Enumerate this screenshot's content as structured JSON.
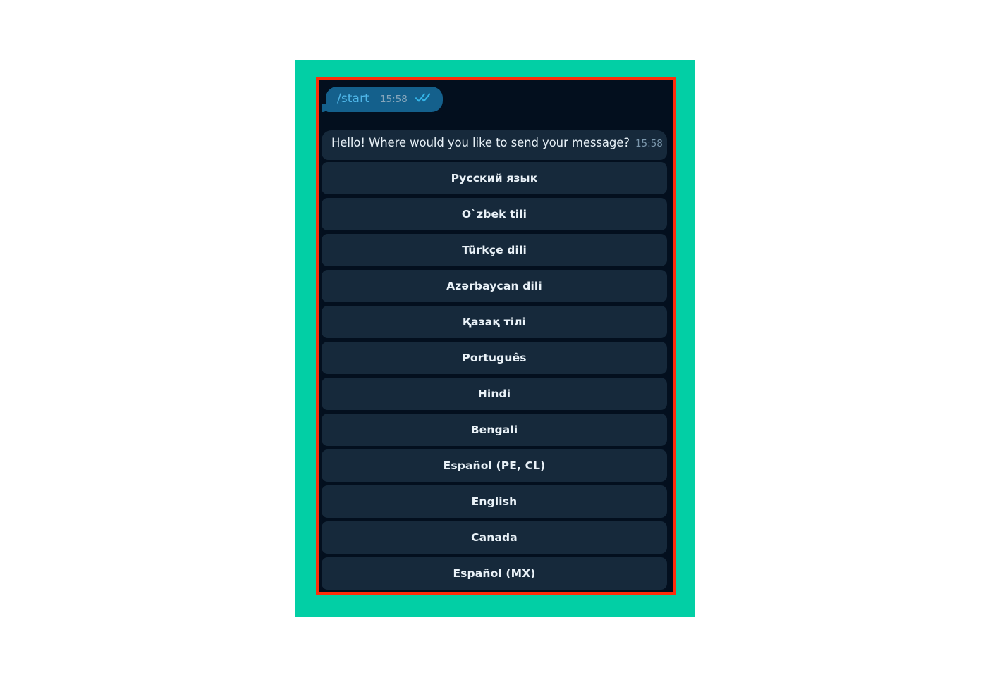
{
  "colors": {
    "highlight_panel": "#02cfa5",
    "annotation_border": "#ff2d0a",
    "chat_background": "#030f1e",
    "outgoing_bubble": "#14608c",
    "incoming_bubble": "#16293b",
    "button_background": "#16293b",
    "button_text": "#eaf2f8",
    "command_text": "#4fb6e8",
    "tick_color": "#34b4e8"
  },
  "chat": {
    "outgoing_message": {
      "text": "/start",
      "time": "15:58",
      "status_icon": "double-check-icon"
    },
    "incoming_message": {
      "text": "Hello! Where would you like to send your message?",
      "time": "15:58"
    },
    "keyboard_buttons": [
      {
        "label": "Русский язык"
      },
      {
        "label": "O`zbek tili"
      },
      {
        "label": "Türkçe dili"
      },
      {
        "label": "Azərbaycan dili"
      },
      {
        "label": "Қазақ тілі"
      },
      {
        "label": "Português"
      },
      {
        "label": "Hindi"
      },
      {
        "label": "Bengali"
      },
      {
        "label": "Español (PE, CL)"
      },
      {
        "label": "English"
      },
      {
        "label": "Canada"
      },
      {
        "label": "Español (MX)"
      }
    ]
  }
}
